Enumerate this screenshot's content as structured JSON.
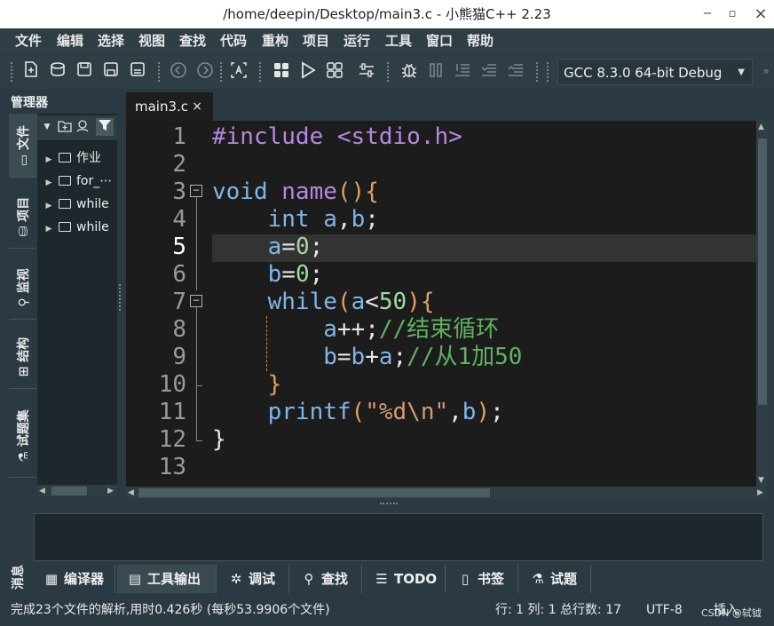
{
  "window": {
    "title": "/home/deepin/Desktop/main3.c - 小熊猫C++ 2.23",
    "minimize": "−",
    "maximize": "▫",
    "close": "×"
  },
  "menu": [
    "文件",
    "编辑",
    "选择",
    "视图",
    "查找",
    "代码",
    "重构",
    "项目",
    "运行",
    "工具",
    "窗口",
    "帮助"
  ],
  "toolbar": {
    "compiler": "GCC 8.3.0 64-bit Debug"
  },
  "left_panel": {
    "title": "管理器",
    "vtabs": [
      "文件",
      "项目",
      "监视",
      "结构",
      "试题集"
    ],
    "tree": [
      "作业",
      "for_⋯",
      "while",
      "while"
    ]
  },
  "editor": {
    "tab": "main3.c",
    "tab_close": "×",
    "line_numbers": [
      "1",
      "2",
      "3",
      "4",
      "5",
      "6",
      "7",
      "8",
      "9",
      "10",
      "11",
      "12",
      "13"
    ]
  },
  "bottom": {
    "panel_label": "消息",
    "tabs": [
      {
        "icon": "▦",
        "label": "编译器"
      },
      {
        "icon": "▤",
        "label": "工具输出"
      },
      {
        "icon": "✲",
        "label": "调试"
      },
      {
        "icon": "⚲",
        "label": "查找"
      },
      {
        "icon": "☰",
        "label": "TODO"
      },
      {
        "icon": "▯",
        "label": "书签"
      },
      {
        "icon": "⚗",
        "label": "试题"
      }
    ]
  },
  "status": {
    "message": "完成23个文件的解析,用时0.426秒 (每秒53.9906个文件)",
    "position": "行: 1 列: 1 总行数: 17",
    "encoding": "UTF-8",
    "mode": "插入",
    "watermark": "CSDN @轼钺"
  }
}
